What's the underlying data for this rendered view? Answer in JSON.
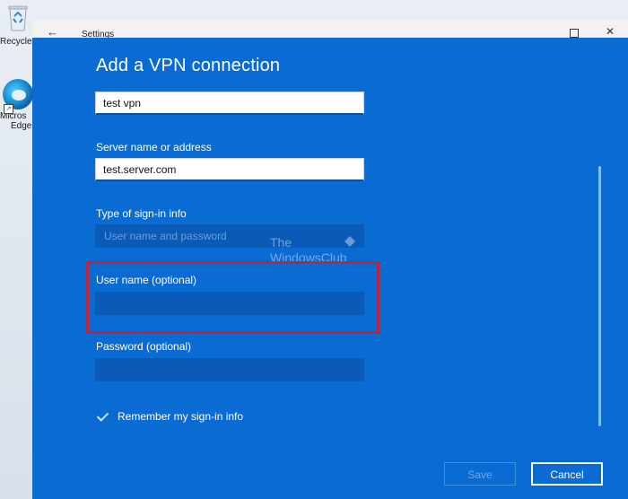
{
  "desktop": {
    "recycle_bin_label": "Recycle",
    "edge_label_line1": "Micros",
    "edge_label_line2": "Edge"
  },
  "window": {
    "title": "Settings"
  },
  "dialog": {
    "title": "Add a VPN connection",
    "connection_name": {
      "value": "test vpn"
    },
    "server": {
      "label": "Server name or address",
      "value": "test.server.com"
    },
    "signin_type": {
      "label": "Type of sign-in info",
      "value": "User name and password"
    },
    "username": {
      "label": "User name (optional)",
      "value": ""
    },
    "password": {
      "label": "Password (optional)",
      "value": ""
    },
    "remember": {
      "label": "Remember my sign-in info",
      "checked": true
    },
    "save_label": "Save",
    "cancel_label": "Cancel"
  },
  "watermark": {
    "line1": "The",
    "line2": "WindowsClub"
  },
  "colors": {
    "dialog_bg": "#0a6bd3",
    "highlight": "#c0243a"
  }
}
